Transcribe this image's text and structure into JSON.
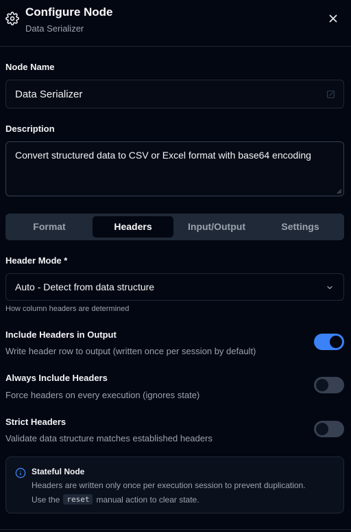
{
  "header": {
    "title": "Configure Node",
    "subtitle": "Data Serializer",
    "icon": "gear-icon",
    "close_icon": "close-icon"
  },
  "node_name": {
    "label": "Node Name",
    "value": "Data Serializer"
  },
  "description": {
    "label": "Description",
    "value": "Convert structured data to CSV or Excel format with base64 encoding"
  },
  "tabs": [
    {
      "label": "Format",
      "active": false
    },
    {
      "label": "Headers",
      "active": true
    },
    {
      "label": "Input/Output",
      "active": false
    },
    {
      "label": "Settings",
      "active": false
    }
  ],
  "header_mode": {
    "label": "Header Mode *",
    "value": "Auto - Detect from data structure",
    "hint": "How column headers are determined"
  },
  "toggles": [
    {
      "title": "Include Headers in Output",
      "description": "Write header row to output (written once per session by default)",
      "on": true
    },
    {
      "title": "Always Include Headers",
      "description": "Force headers on every execution (ignores state)",
      "on": false
    },
    {
      "title": "Strict Headers",
      "description": "Validate data structure matches established headers",
      "on": false
    }
  ],
  "info": {
    "title": "Stateful Node",
    "line1": "Headers are written only once per execution session to prevent duplication.",
    "line2_prefix": "Use the",
    "code": "reset",
    "line2_suffix": "manual action to clear state.",
    "icon": "info-icon"
  },
  "colors": {
    "background": "#030712",
    "accent": "#3b82f6",
    "border": "#1f2937"
  }
}
